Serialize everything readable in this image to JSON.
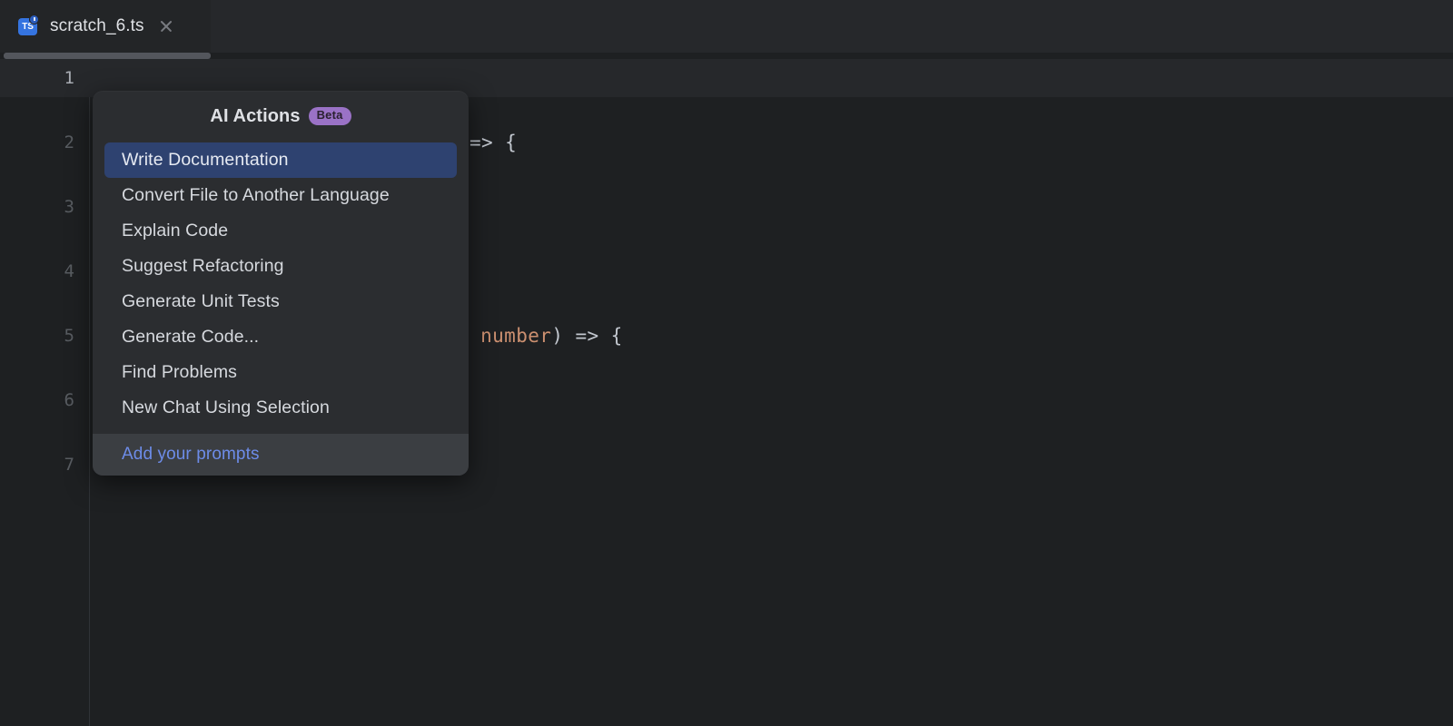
{
  "window": {
    "background_color": "#1e2022"
  },
  "tabbar": {
    "tab": {
      "icon_name": "typescript-file-icon",
      "icon_label": "TS",
      "title": "scratch_6.ts",
      "close_label": "×"
    }
  },
  "editor": {
    "lines": [
      {
        "number": "1",
        "code": "",
        "current": true
      },
      {
        "number": "2",
        "code": "=> {"
      },
      {
        "number": "3",
        "code": ""
      },
      {
        "number": "4",
        "code": ""
      },
      {
        "number": "5",
        "code_prefix": ": ",
        "code_type": "number",
        "code_suffix": ") => {"
      },
      {
        "number": "6",
        "code": ""
      },
      {
        "number": "7",
        "code": ""
      }
    ],
    "type_token_color": "#cc9070"
  },
  "popup": {
    "title": "AI Actions",
    "badge": "Beta",
    "badge_color": "#9a72c6",
    "selected_color": "#2e4270",
    "items": [
      {
        "label": "Write Documentation",
        "selected": true
      },
      {
        "label": "Convert File to Another Language",
        "selected": false
      },
      {
        "label": "Explain Code",
        "selected": false
      },
      {
        "label": "Suggest Refactoring",
        "selected": false
      },
      {
        "label": "Generate Unit Tests",
        "selected": false
      },
      {
        "label": "Generate Code...",
        "selected": false
      },
      {
        "label": "Find Problems",
        "selected": false
      },
      {
        "label": "New Chat Using Selection",
        "selected": false
      }
    ],
    "footer": {
      "link_label": "Add your prompts",
      "link_color": "#6d8ce8"
    }
  }
}
